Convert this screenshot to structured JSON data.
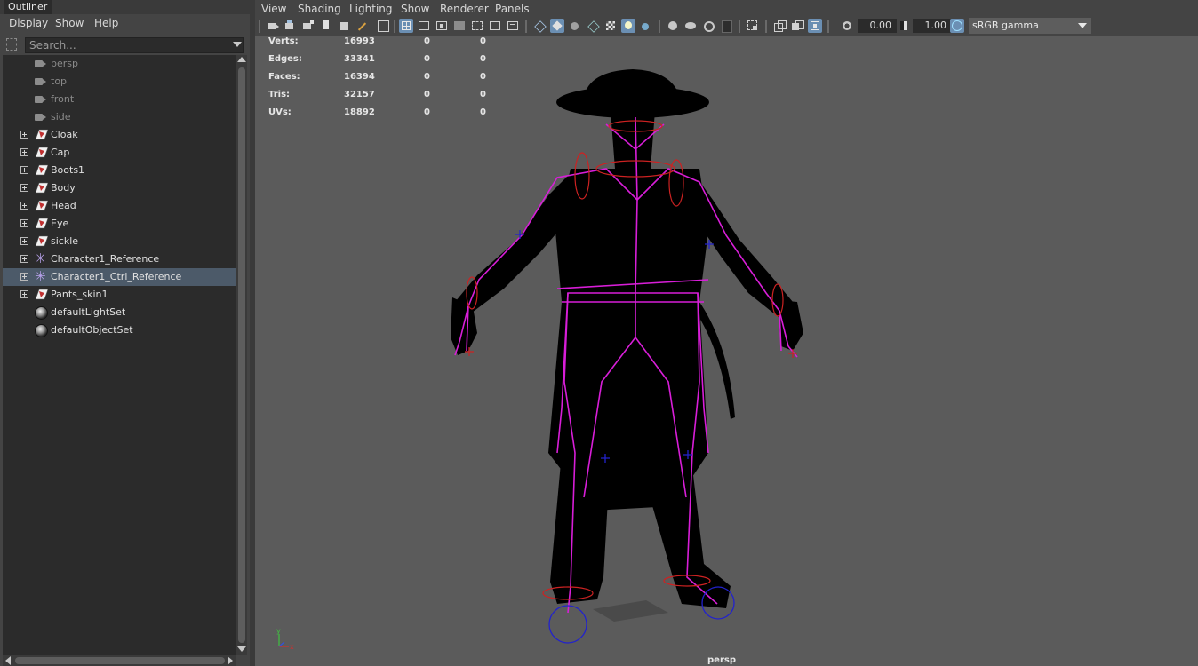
{
  "outliner": {
    "tab_title": "Outliner",
    "menu": [
      "Display",
      "Show",
      "Help"
    ],
    "search_placeholder": "Search...",
    "items": [
      {
        "label": "persp",
        "icon": "camera-icon",
        "dim": true,
        "expandable": false,
        "selected": false
      },
      {
        "label": "top",
        "icon": "camera-icon",
        "dim": true,
        "expandable": false,
        "selected": false
      },
      {
        "label": "front",
        "icon": "camera-icon",
        "dim": true,
        "expandable": false,
        "selected": false
      },
      {
        "label": "side",
        "icon": "camera-icon",
        "dim": true,
        "expandable": false,
        "selected": false
      },
      {
        "label": "Cloak",
        "icon": "mesh-icon",
        "dim": false,
        "expandable": true,
        "selected": false
      },
      {
        "label": "Cap",
        "icon": "mesh-icon",
        "dim": false,
        "expandable": true,
        "selected": false
      },
      {
        "label": "Boots1",
        "icon": "mesh-icon",
        "dim": false,
        "expandable": true,
        "selected": false
      },
      {
        "label": "Body",
        "icon": "mesh-icon",
        "dim": false,
        "expandable": true,
        "selected": false
      },
      {
        "label": "Head",
        "icon": "mesh-icon",
        "dim": false,
        "expandable": true,
        "selected": false
      },
      {
        "label": "Eye",
        "icon": "mesh-icon",
        "dim": false,
        "expandable": true,
        "selected": false
      },
      {
        "label": "sickle",
        "icon": "mesh-icon",
        "dim": false,
        "expandable": true,
        "selected": false
      },
      {
        "label": "Character1_Reference",
        "icon": "reference-icon",
        "dim": false,
        "expandable": true,
        "selected": false
      },
      {
        "label": "Character1_Ctrl_Reference",
        "icon": "reference-icon",
        "dim": false,
        "expandable": true,
        "selected": true
      },
      {
        "label": "Pants_skin1",
        "icon": "mesh-icon",
        "dim": false,
        "expandable": true,
        "selected": false
      },
      {
        "label": "defaultLightSet",
        "icon": "set-icon",
        "dim": false,
        "expandable": false,
        "selected": false
      },
      {
        "label": "defaultObjectSet",
        "icon": "set-icon",
        "dim": false,
        "expandable": false,
        "selected": false
      }
    ]
  },
  "viewport": {
    "menu": [
      "View",
      "Shading",
      "Lighting",
      "Show",
      "Renderer",
      "Panels"
    ],
    "toolbar": {
      "exposure": "0.00",
      "gamma": "1.00",
      "color_space": "sRGB gamma",
      "active_buttons": [
        "wireframe-grid-button",
        "smooth-shade-button",
        "xray-joints-button",
        "color-management-button"
      ]
    },
    "hud": [
      {
        "label": "Verts:",
        "values": [
          "16993",
          "0",
          "0"
        ]
      },
      {
        "label": "Edges:",
        "values": [
          "33341",
          "0",
          "0"
        ]
      },
      {
        "label": "Faces:",
        "values": [
          "16394",
          "0",
          "0"
        ]
      },
      {
        "label": "Tris:",
        "values": [
          "32157",
          "0",
          "0"
        ]
      },
      {
        "label": "UVs:",
        "values": [
          "18892",
          "0",
          "0"
        ]
      }
    ],
    "camera_label": "persp",
    "axis_labels": {
      "x": "x",
      "y": "y"
    },
    "colors": {
      "background": "#5b5b5b",
      "silhouette": "#000000",
      "skeleton": "#d81ed8",
      "ik_handle": "#cc2222",
      "pole_vector": "#2222cc",
      "selection": "#4c5a69"
    }
  }
}
